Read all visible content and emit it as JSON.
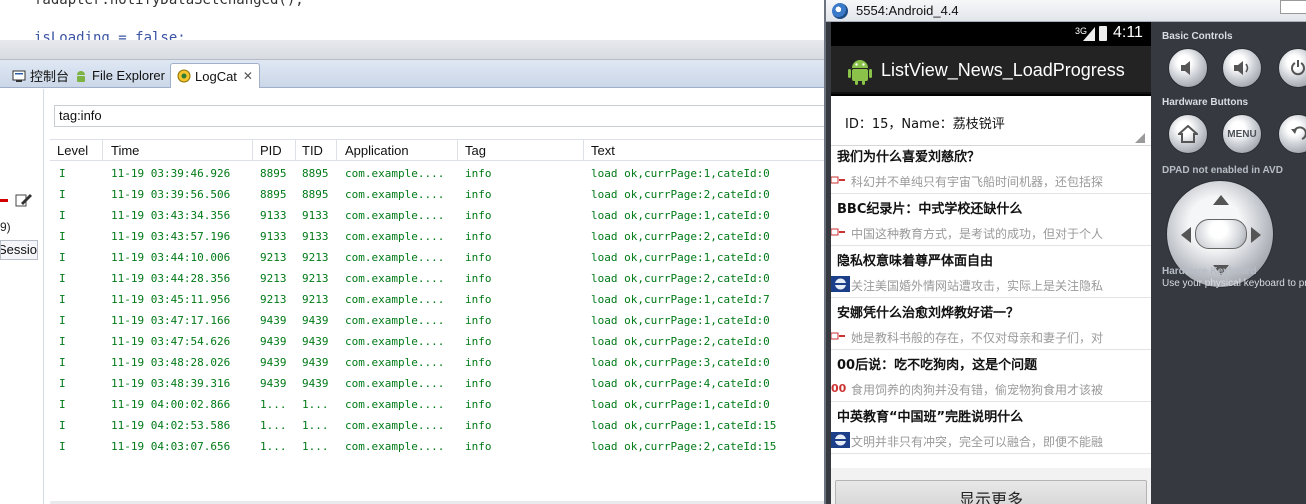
{
  "code": {
    "line1": "fadapter.notifyDataSetChanged();",
    "line2": "isLoading = false;"
  },
  "eclipse_tabs": [
    {
      "label": "控制台",
      "icon": "console-icon"
    },
    {
      "label": "File Explorer",
      "icon": "android-icon"
    },
    {
      "label": "LogCat",
      "icon": "logcat-icon",
      "active": true,
      "close": "✕"
    }
  ],
  "left_panel": {
    "count_label": "9)",
    "session_label": "Sessio"
  },
  "logcat": {
    "filter_value": "tag:info",
    "columns": [
      "Level",
      "Time",
      "PID",
      "TID",
      "Application",
      "Tag",
      "Text"
    ],
    "rows": [
      [
        "I",
        "11-19 03:39:46.926",
        "8895",
        "8895",
        "com.example....",
        "info",
        "load ok,currPage:1,cateId:0"
      ],
      [
        "I",
        "11-19 03:39:56.506",
        "8895",
        "8895",
        "com.example....",
        "info",
        "load ok,currPage:2,cateId:0"
      ],
      [
        "I",
        "11-19 03:43:34.356",
        "9133",
        "9133",
        "com.example....",
        "info",
        "load ok,currPage:1,cateId:0"
      ],
      [
        "I",
        "11-19 03:43:57.196",
        "9133",
        "9133",
        "com.example....",
        "info",
        "load ok,currPage:2,cateId:0"
      ],
      [
        "I",
        "11-19 03:44:10.006",
        "9213",
        "9213",
        "com.example....",
        "info",
        "load ok,currPage:1,cateId:0"
      ],
      [
        "I",
        "11-19 03:44:28.356",
        "9213",
        "9213",
        "com.example....",
        "info",
        "load ok,currPage:2,cateId:0"
      ],
      [
        "I",
        "11-19 03:45:11.956",
        "9213",
        "9213",
        "com.example....",
        "info",
        "load ok,currPage:1,cateId:7"
      ],
      [
        "I",
        "11-19 03:47:17.166",
        "9439",
        "9439",
        "com.example....",
        "info",
        "load ok,currPage:1,cateId:0"
      ],
      [
        "I",
        "11-19 03:47:54.626",
        "9439",
        "9439",
        "com.example....",
        "info",
        "load ok,currPage:2,cateId:0"
      ],
      [
        "I",
        "11-19 03:48:28.026",
        "9439",
        "9439",
        "com.example....",
        "info",
        "load ok,currPage:3,cateId:0"
      ],
      [
        "I",
        "11-19 03:48:39.316",
        "9439",
        "9439",
        "com.example....",
        "info",
        "load ok,currPage:4,cateId:0"
      ],
      [
        "I",
        "11-19 04:00:02.866",
        "1...",
        "1...",
        "com.example....",
        "info",
        "load ok,currPage:1,cateId:0"
      ],
      [
        "I",
        "11-19 04:02:53.586",
        "1...",
        "1...",
        "com.example....",
        "info",
        "load ok,currPage:1,cateId:15"
      ],
      [
        "I",
        "11-19 04:03:07.656",
        "1...",
        "1...",
        "com.example....",
        "info",
        "load ok,currPage:2,cateId:15"
      ]
    ],
    "text_color": "#007a17"
  },
  "emulator": {
    "window_title": "5554:Android_4.4",
    "status": {
      "network": "3G",
      "time": "4:11"
    },
    "app_title": "ListView_News_LoadProgress",
    "spinner_value": "ID：15，Name：荔枝锐评",
    "news": [
      {
        "title": "我们为什么喜爱刘慈欣？",
        "summary": "科幻并不单纯只有宇宙飞船时间机器，还包括探",
        "thumb": "broken-image-icon"
      },
      {
        "title": "BBC纪录片：中式学校还缺什么",
        "summary": "中国这种教育方式，是考试的成功，但对于个人",
        "thumb": "broken-image-icon"
      },
      {
        "title": "隐私权意味着尊严体面自由",
        "summary": "关注美国婚外情网站遭攻击，实际上是关注隐私",
        "thumb": "news-thumb-icon"
      },
      {
        "title": "安娜凭什么治愈刘烨教好诺一？",
        "summary": "她是教科书般的存在，不仅对母亲和妻子们，对",
        "thumb": "broken-image-icon"
      },
      {
        "title": "00后说：吃不吃狗肉，这是个问题",
        "summary": "食用饲养的肉狗并没有错，偷宠物狗食用才该被",
        "thumb": "broken-image-00-icon"
      },
      {
        "title": "中英教育“中国班”完胜说明什么",
        "summary": "文明并非只有冲突，完全可以融合，即便不能融",
        "thumb": "news-thumb-icon"
      }
    ],
    "more_button": "显示更多",
    "controls": {
      "basic_label": "Basic Controls",
      "hardware_label": "Hardware Buttons",
      "dpad_label": "DPAD not enabled in AVD",
      "keyboard_label": "Hardware Keyboard",
      "keyboard_hint": "Use your physical keyboard to pr",
      "menu_label": "MENU"
    }
  }
}
